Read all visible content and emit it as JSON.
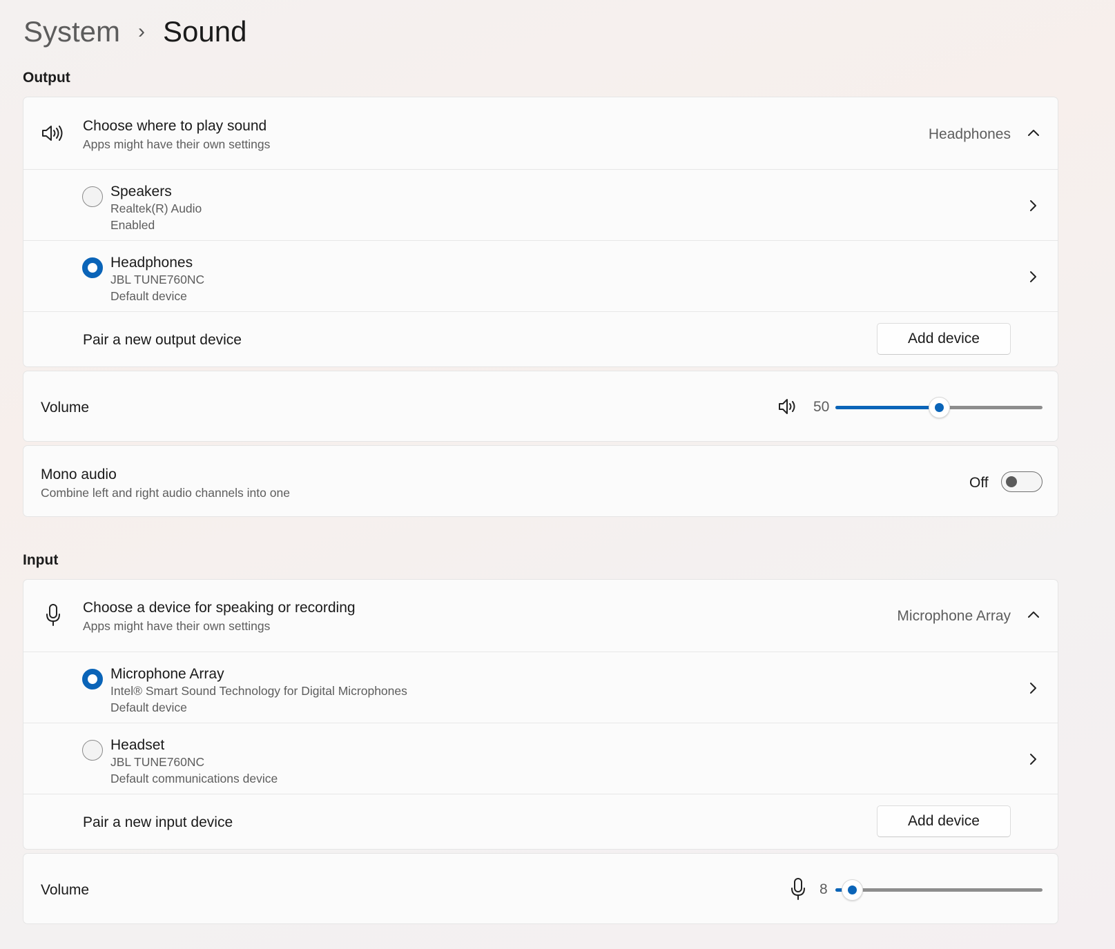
{
  "breadcrumb": {
    "parent": "System",
    "separator": "›",
    "current": "Sound"
  },
  "output": {
    "section_title": "Output",
    "chooser": {
      "title": "Choose where to play sound",
      "subtitle": "Apps might have their own settings",
      "selected": "Headphones",
      "icon": "speaker-icon"
    },
    "devices": [
      {
        "name": "Speakers",
        "detail": "Realtek(R) Audio",
        "status": "Enabled",
        "selected": false
      },
      {
        "name": "Headphones",
        "detail": "JBL TUNE760NC",
        "status": "Default device",
        "selected": true
      }
    ],
    "pair": {
      "label": "Pair a new output device",
      "button": "Add device"
    },
    "volume": {
      "label": "Volume",
      "value": "50",
      "level_percent": 50
    },
    "mono": {
      "title": "Mono audio",
      "subtitle": "Combine left and right audio channels into one",
      "state": "Off",
      "enabled": false
    }
  },
  "input": {
    "section_title": "Input",
    "chooser": {
      "title": "Choose a device for speaking or recording",
      "subtitle": "Apps might have their own settings",
      "selected": "Microphone Array",
      "icon": "microphone-icon"
    },
    "devices": [
      {
        "name": "Microphone Array",
        "detail": "Intel® Smart Sound Technology for Digital Microphones",
        "status": "Default device",
        "selected": true
      },
      {
        "name": "Headset",
        "detail": "JBL TUNE760NC",
        "status": "Default communications device",
        "selected": false
      }
    ],
    "pair": {
      "label": "Pair a new input device",
      "button": "Add device"
    },
    "volume": {
      "label": "Volume",
      "value": "8",
      "level_percent": 8
    }
  },
  "colors": {
    "accent": "#0a64b8",
    "card": "#fbfbfb",
    "border": "#e5e5e5"
  }
}
